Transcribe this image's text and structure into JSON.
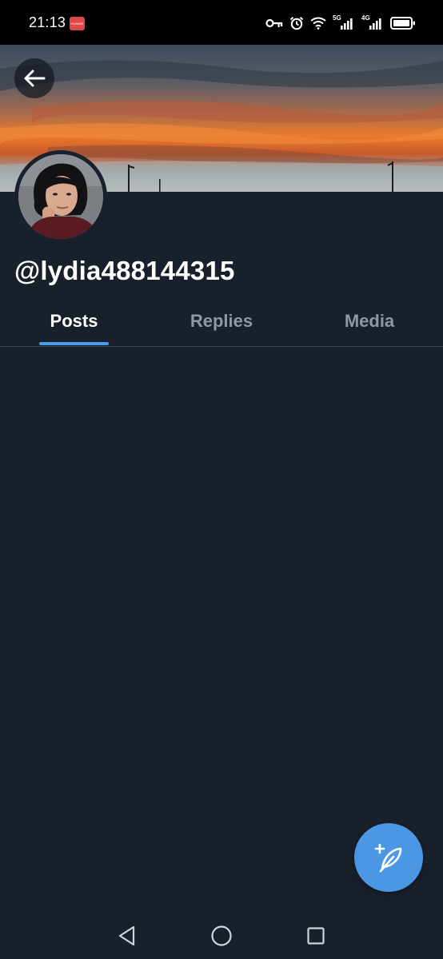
{
  "status_bar": {
    "time": "21:13",
    "app_badge_text": "HUAWEI",
    "network_1": "5G",
    "network_2": "4G",
    "icons": [
      "vpn-key-icon",
      "alarm-icon",
      "wifi-icon",
      "signal-5g-icon",
      "signal-4g-icon",
      "battery-icon"
    ]
  },
  "profile": {
    "username": "@lydia488144315"
  },
  "tabs": [
    {
      "label": "Posts",
      "active": true
    },
    {
      "label": "Replies",
      "active": false
    },
    {
      "label": "Media",
      "active": false
    }
  ],
  "colors": {
    "background": "#18202b",
    "accent": "#4a99e9",
    "tab_inactive": "#8b98a5",
    "divider": "#38444d"
  },
  "nav_icons": [
    "back-triangle-icon",
    "home-circle-icon",
    "recents-square-icon"
  ],
  "fab_icon": "compose-feather-plus-icon"
}
